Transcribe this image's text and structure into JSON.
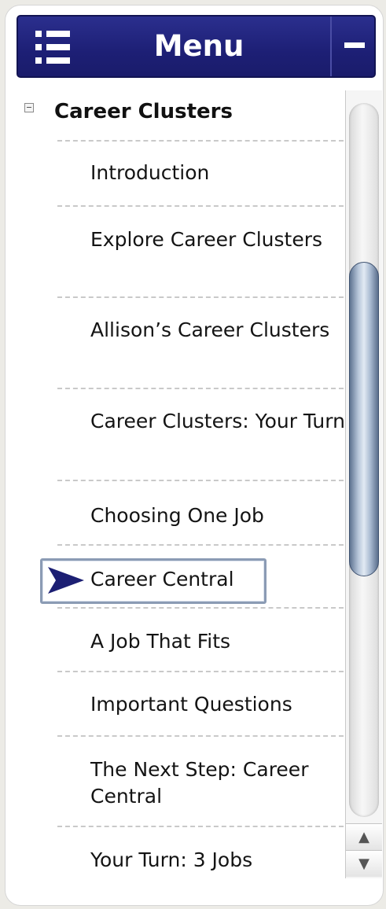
{
  "header": {
    "title": "Menu",
    "menu_icon": "list-icon",
    "collapse_icon": "minus-icon",
    "bg_color": "#1f2178"
  },
  "section": {
    "title": "Career Clusters",
    "toggle_icon": "collapse-box-icon"
  },
  "items": [
    {
      "label": "Introduction",
      "current": false
    },
    {
      "label": "Explore Career Clusters",
      "current": false
    },
    {
      "label": "Allison’s Career Clusters",
      "current": false
    },
    {
      "label": "Career Clusters: Your Turn",
      "current": false
    },
    {
      "label": "Choosing One Job",
      "current": false
    },
    {
      "label": "Career Central",
      "current": true
    },
    {
      "label": "A Job That Fits",
      "current": false
    },
    {
      "label": "Important Questions",
      "current": false
    },
    {
      "label": "The Next Step: Career Central",
      "current": false
    },
    {
      "label": "Your Turn: 3 Jobs",
      "current": false
    }
  ],
  "current_indicator": {
    "icon": "arrow-right-icon",
    "color": "#1c1f73"
  },
  "scrollbar": {
    "up_icon": "▲",
    "down_icon": "▼"
  }
}
